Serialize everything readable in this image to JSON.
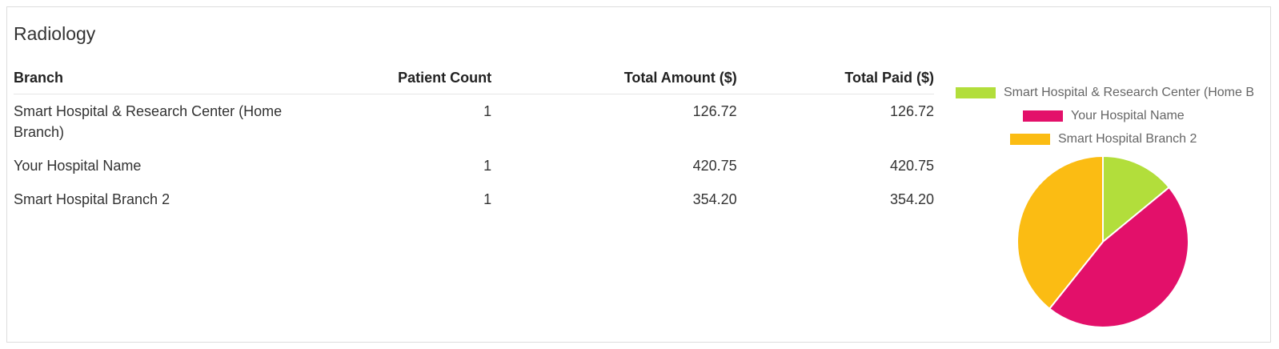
{
  "panel": {
    "title": "Radiology"
  },
  "table": {
    "headers": {
      "branch": "Branch",
      "patient_count": "Patient Count",
      "total_amount": "Total Amount ($)",
      "total_paid": "Total Paid ($)"
    },
    "rows": [
      {
        "branch": "Smart Hospital & Research Center (Home Branch)",
        "patient_count": "1",
        "total_amount": "126.72",
        "total_paid": "126.72"
      },
      {
        "branch": "Your Hospital Name",
        "patient_count": "1",
        "total_amount": "420.75",
        "total_paid": "420.75"
      },
      {
        "branch": "Smart Hospital Branch 2",
        "patient_count": "1",
        "total_amount": "354.20",
        "total_paid": "354.20"
      }
    ]
  },
  "chart_data": {
    "type": "pie",
    "categories": [
      "Smart Hospital & Research Center (Home Branch)",
      "Your Hospital Name",
      "Smart Hospital Branch 2"
    ],
    "values": [
      126.72,
      420.75,
      354.2
    ],
    "colors": [
      "#b2de3b",
      "#e3106a",
      "#fbbc13"
    ],
    "legend": "top"
  }
}
